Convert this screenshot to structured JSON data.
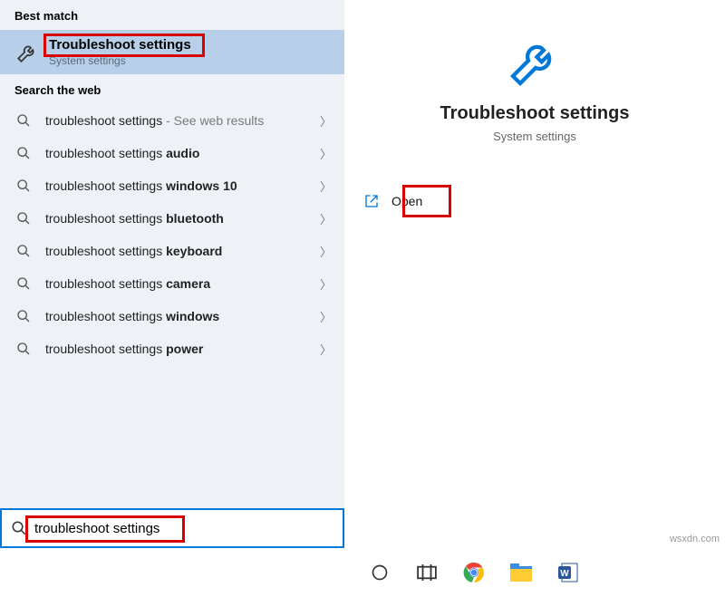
{
  "sections": {
    "best_match": "Best match",
    "search_web": "Search the web"
  },
  "best_match": {
    "title": "Troubleshoot settings",
    "subtitle": "System settings"
  },
  "results": [
    {
      "prefix": "troubleshoot settings",
      "suffix": "",
      "hint": " - See web results"
    },
    {
      "prefix": "troubleshoot settings ",
      "suffix": "audio",
      "hint": ""
    },
    {
      "prefix": "troubleshoot settings ",
      "suffix": "windows 10",
      "hint": ""
    },
    {
      "prefix": "troubleshoot settings ",
      "suffix": "bluetooth",
      "hint": ""
    },
    {
      "prefix": "troubleshoot settings ",
      "suffix": "keyboard",
      "hint": ""
    },
    {
      "prefix": "troubleshoot settings ",
      "suffix": "camera",
      "hint": ""
    },
    {
      "prefix": "troubleshoot settings ",
      "suffix": "windows",
      "hint": ""
    },
    {
      "prefix": "troubleshoot settings ",
      "suffix": "power",
      "hint": ""
    }
  ],
  "preview": {
    "title": "Troubleshoot settings",
    "subtitle": "System settings",
    "open_label": "Open"
  },
  "search": {
    "value": "troubleshoot settings"
  },
  "watermark": "wsxdn.com",
  "colors": {
    "accent": "#0078d7",
    "highlight_red": "#d90000",
    "selected_bg": "#b7cfe8"
  }
}
